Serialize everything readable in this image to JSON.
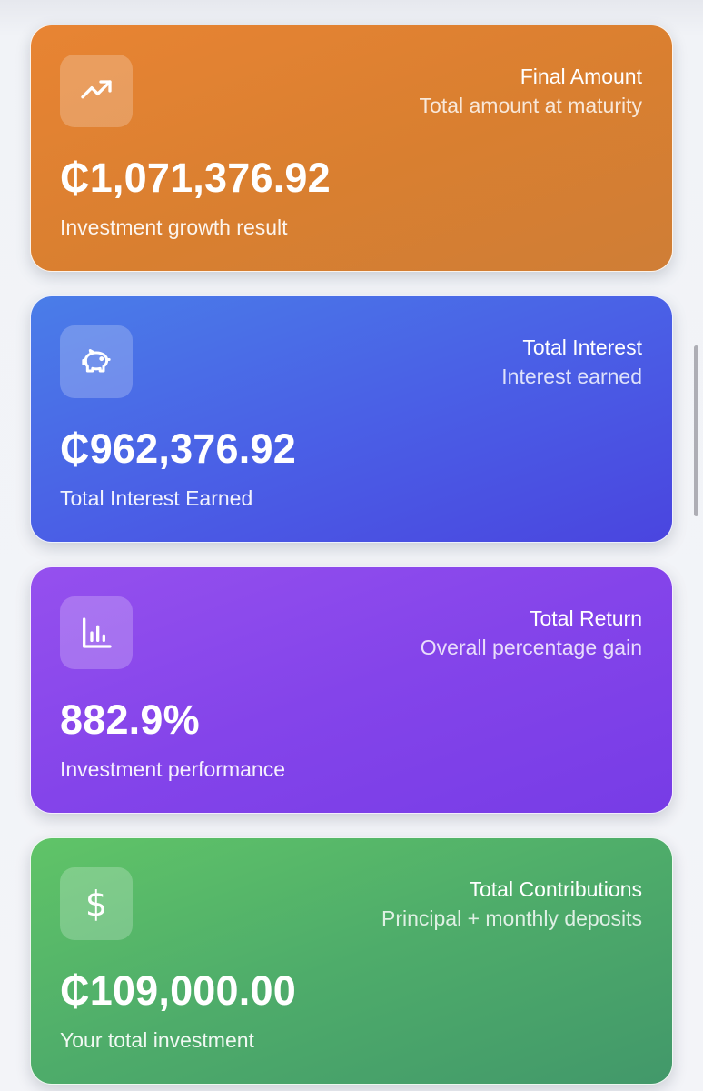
{
  "cards": [
    {
      "icon": "trending-up-icon",
      "title": "Final Amount",
      "subtitle": "Total amount at maturity",
      "value": "₵1,071,376.92",
      "caption": "Investment growth result",
      "color": "#e07f32"
    },
    {
      "icon": "piggy-bank-icon",
      "title": "Total Interest",
      "subtitle": "Interest earned",
      "value": "₵962,376.92",
      "caption": "Total Interest Earned",
      "color": "#4a5ce5"
    },
    {
      "icon": "bar-chart-icon",
      "title": "Total Return",
      "subtitle": "Overall percentage gain",
      "value": "882.9%",
      "caption": "Investment performance",
      "color": "#8444ea"
    },
    {
      "icon": "dollar-icon",
      "icon_glyph": "$",
      "title": "Total Contributions",
      "subtitle": "Principal + monthly deposits",
      "value": "₵109,000.00",
      "caption": "Your total investment",
      "color": "#4eac6a"
    }
  ]
}
